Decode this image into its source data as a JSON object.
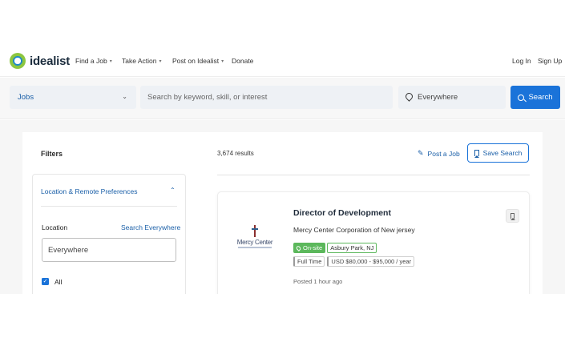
{
  "brand": {
    "name": "idealist"
  },
  "nav": {
    "items": [
      {
        "label": "Find a Job",
        "dropdown": true
      },
      {
        "label": "Take Action",
        "dropdown": true
      },
      {
        "label": "Post on Idealist",
        "dropdown": true
      },
      {
        "label": "Donate",
        "dropdown": false
      }
    ],
    "login": "Log In",
    "signup": "Sign Up"
  },
  "search": {
    "category": "Jobs",
    "keyword_placeholder": "Search by keyword, skill, or interest",
    "location": "Everywhere",
    "button": "Search"
  },
  "filters": {
    "title": "Filters",
    "section": "Location & Remote Preferences",
    "location_label": "Location",
    "search_everywhere": "Search Everywhere",
    "location_value": "Everywhere",
    "all_checkbox": {
      "label": "All",
      "checked": true
    }
  },
  "results": {
    "count": "3,674 results",
    "post_job": "Post a Job",
    "save_search": "Save Search"
  },
  "job": {
    "title": "Director of Development",
    "org": "Mercy Center Corporation of New jersey",
    "org_logo_text": "Mercy Center",
    "onsite": "On-site",
    "location": "Asbury Park, NJ",
    "type": "Full Time",
    "salary": "USD $80,000 - $95,000 / year",
    "posted": "Posted 1 hour ago"
  },
  "colors": {
    "accent": "#1a73d9",
    "link": "#1a5fa8",
    "onsite": "#5cb85c"
  }
}
